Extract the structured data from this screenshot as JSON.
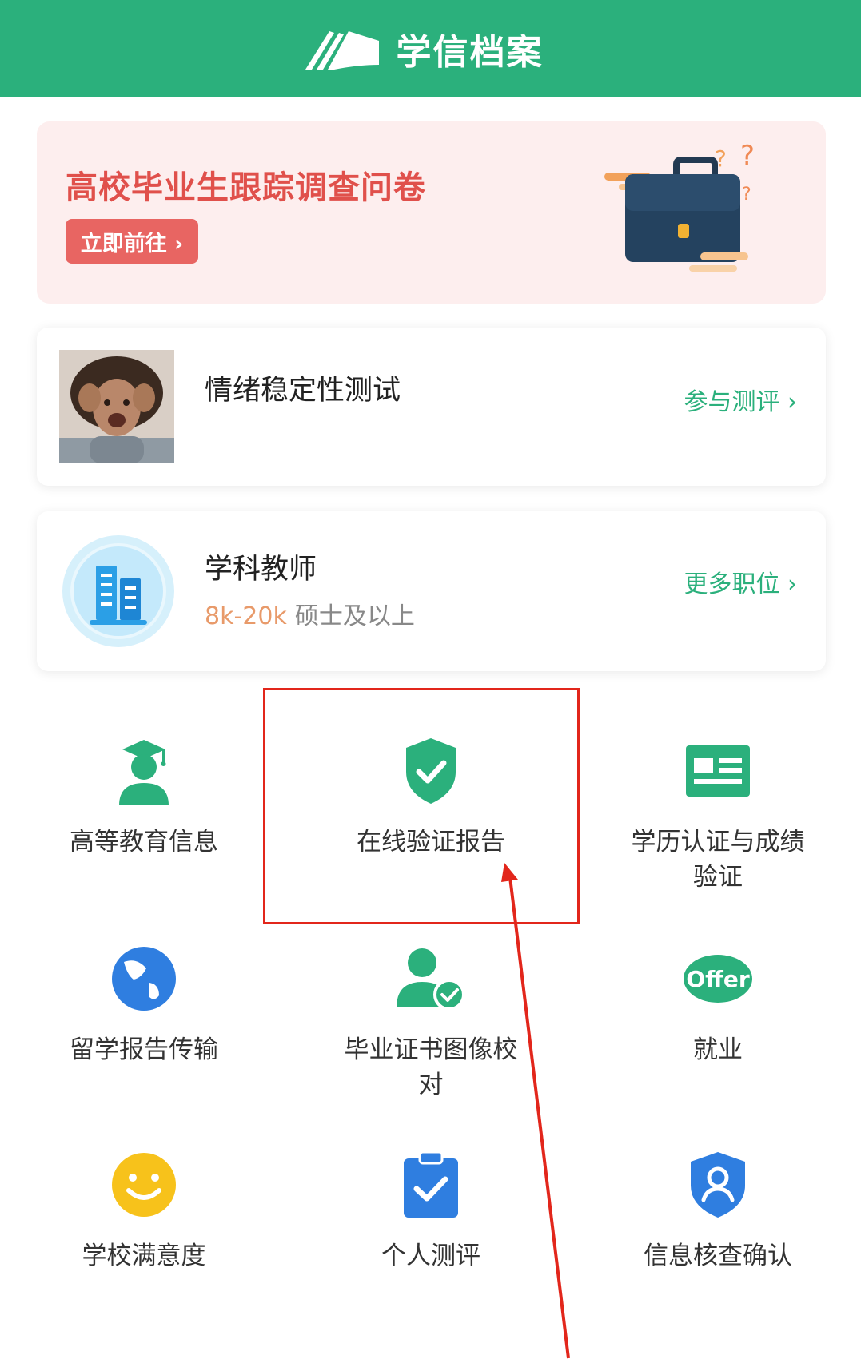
{
  "header": {
    "title": "学信档案"
  },
  "banner": {
    "title": "高校毕业生跟踪调查问卷",
    "button_label": "立即前往 ›"
  },
  "cards": [
    {
      "title": "情绪稳定性测试",
      "link": "参与测评 ›"
    },
    {
      "title": "学科教师",
      "salary": "8k-20k",
      "requirement": "硕士及以上",
      "link": "更多职位 ›"
    }
  ],
  "grid": [
    {
      "label": "高等教育信息",
      "icon": "graduate-icon"
    },
    {
      "label": "在线验证报告",
      "icon": "shield-check-icon"
    },
    {
      "label": "学历认证与成绩验证",
      "icon": "id-card-icon"
    },
    {
      "label": "留学报告传输",
      "icon": "globe-icon"
    },
    {
      "label": "毕业证书图像校对",
      "icon": "user-check-icon"
    },
    {
      "label": "就业",
      "icon": "offer-icon"
    },
    {
      "label": "学校满意度",
      "icon": "smiley-icon"
    },
    {
      "label": "个人测评",
      "icon": "clipboard-check-icon"
    },
    {
      "label": "信息核查确认",
      "icon": "shield-user-icon"
    }
  ],
  "colors": {
    "brand": "#2bb07c",
    "banner_text": "#e0504b",
    "annotation": "#e2261b"
  }
}
